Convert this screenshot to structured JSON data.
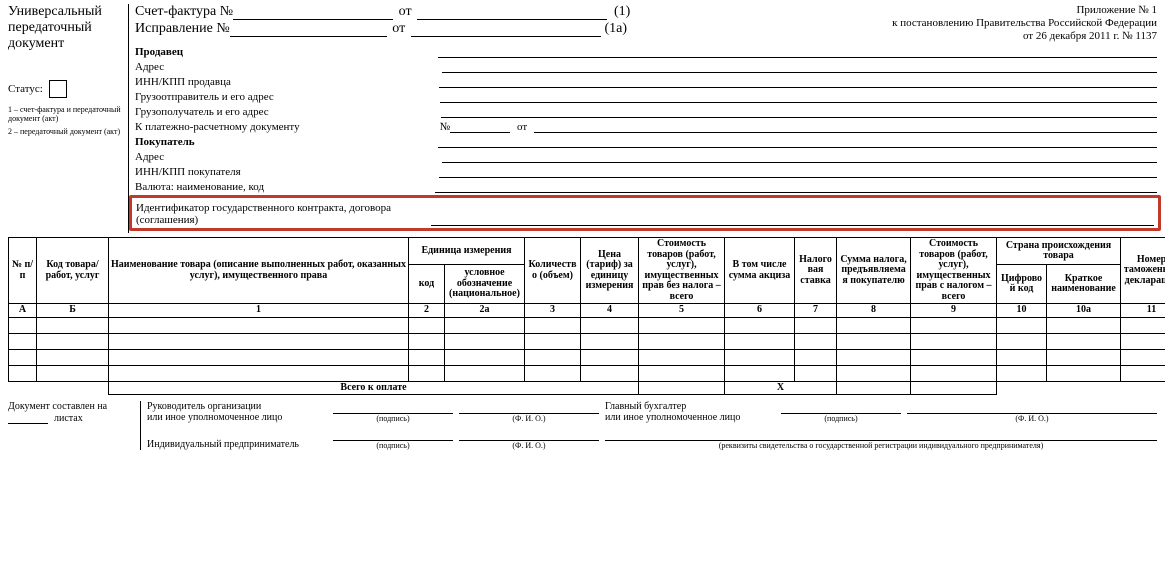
{
  "doc_title": "Универсальный передаточный документ",
  "status_label": "Статус:",
  "left_note1": "1 – счет-фактура и передаточный документ (акт)",
  "left_note2": "2 – передаточный документ (акт)",
  "header": {
    "invoice_label": "Счет-фактура №",
    "correction_label": "Исправление №",
    "ot": "от",
    "paren1": "(1)",
    "paren1a": "(1а)"
  },
  "appendix": {
    "l1": "Приложение № 1",
    "l2": "к постановлению Правительства Российской Федерации",
    "l3": "от 26 декабря 2011 г. № 1137"
  },
  "fields": {
    "seller": "Продавец",
    "address": "Адрес",
    "seller_inn": "ИНН/КПП продавца",
    "consignor": "Грузоотправитель и его адрес",
    "consignee": "Грузополучатель и его адрес",
    "payment_doc": "К платежно-расчетному документу",
    "num_sym": "№",
    "buyer": "Покупатель",
    "buyer_inn": "ИНН/КПП покупателя",
    "currency": "Валюта: наименование, код",
    "gov_contract_l1": "Идентификатор государственного контракта, договора",
    "gov_contract_l2": "(соглашения)"
  },
  "table": {
    "col_np": "№ п/п",
    "col_code": "Код товара/ работ, услуг",
    "col_name": "Наименование товара (описание выполненных работ, оказанных услуг), имущественного права",
    "col_unit": "Единица измерения",
    "col_unit_code": "код",
    "col_unit_name": "условное обозначение (национальное)",
    "col_qty": "Количество (объем)",
    "col_price": "Цена (тариф) за единицу измерения",
    "col_cost_no_tax": "Стоимость товаров (работ, услуг), имущественных прав без налога – всего",
    "col_excise": "В том числе сумма акциза",
    "col_rate": "Налоговая ставка",
    "col_tax": "Сумма налога, предъявляемая покупателю",
    "col_cost_tax": "Стоимость товаров (работ, услуг), имущественных прав с налогом – всего",
    "col_country": "Страна происхождения товара",
    "col_country_code": "Цифровой код",
    "col_country_name": "Краткое наименование",
    "col_decl": "Номер таможенной декларации",
    "num_a": "А",
    "num_b": "Б",
    "num_1": "1",
    "num_2": "2",
    "num_2a": "2а",
    "num_3": "3",
    "num_4": "4",
    "num_5": "5",
    "num_6": "6",
    "num_7": "7",
    "num_8": "8",
    "num_9": "9",
    "num_10": "10",
    "num_10a": "10а",
    "num_11": "11",
    "totals_label": "Всего к оплате",
    "x": "Х"
  },
  "sig": {
    "doc_compiled": "Документ составлен на",
    "sheets": "листах",
    "head": "Руководитель организации",
    "or_auth": "или иное уполномоченное лицо",
    "chief_acc": "Главный бухгалтер",
    "ip": "Индивидуальный предприниматель",
    "podpis": "(подпись)",
    "fio": "(Ф. И. О.)",
    "req": "(реквизиты свидетельства о государственной регистрации индивидуального предпринимателя)"
  }
}
